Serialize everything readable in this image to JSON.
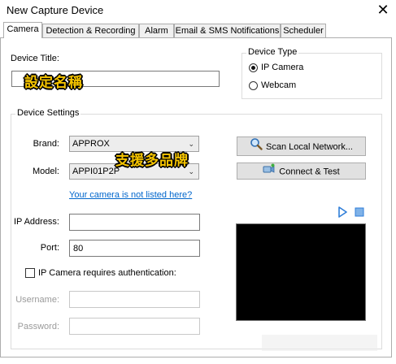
{
  "window": {
    "title": "New Capture Device",
    "close_glyph": "✕"
  },
  "tabs": [
    {
      "label": "Camera",
      "active": true
    },
    {
      "label": "Detection & Recording"
    },
    {
      "label": "Alarm"
    },
    {
      "label": "Email & SMS Notifications"
    },
    {
      "label": "Scheduler"
    }
  ],
  "device_title": {
    "label": "Device Title:",
    "value": ""
  },
  "device_type": {
    "legend": "Device Type",
    "options": [
      {
        "label": "IP Camera",
        "selected": true
      },
      {
        "label": "Webcam",
        "selected": false
      }
    ]
  },
  "device_settings": {
    "legend": "Device Settings",
    "brand_label": "Brand:",
    "brand_value": "APPROX",
    "model_label": "Model:",
    "model_value": "APPI01P2P",
    "not_listed_link": "Your camera is not listed here?",
    "ip_label": "IP Address:",
    "ip_value": "",
    "port_label": "Port:",
    "port_value": "80",
    "auth_label": "IP Camera requires authentication:",
    "auth_checked": false,
    "username_label": "Username:",
    "password_label": "Password:"
  },
  "buttons": {
    "scan_label": "Scan Local Network...",
    "connect_label": "Connect & Test"
  },
  "overlays": {
    "title_annotation": "設定名稱",
    "brand_annotation": "支援多品牌"
  },
  "icons": {
    "scan": "magnifier-icon",
    "connect": "camera-connect-icon",
    "play": "play-icon",
    "stop": "stop-icon"
  }
}
